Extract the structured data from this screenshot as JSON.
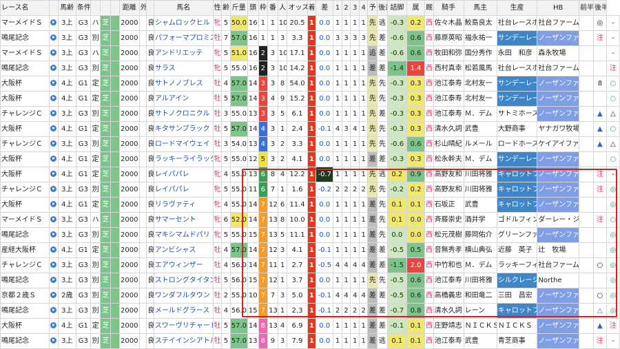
{
  "headers": [
    "レース名",
    "",
    "馬齢",
    "条件",
    "",
    "",
    "",
    "距離",
    "外",
    "",
    "馬名",
    "性",
    "齢",
    "斤量",
    "頭",
    "枠",
    "番",
    "人",
    "オッズ",
    "着",
    "差",
    "1",
    "2",
    "3",
    "4",
    "予",
    "後差",
    "詰脚",
    "属",
    "厩舎",
    "騎手",
    "馬主",
    "生産",
    "HB",
    "前半",
    "後半"
  ],
  "rows": [
    [
      "マーメイドＳ",
      "",
      "3上",
      "G3",
      "ハ",
      "芝",
      "",
      "2000",
      "",
      "良",
      "シャムロックヒル",
      "牝",
      "5",
      "50.0",
      "16",
      "1",
      "1",
      "10",
      "20.5",
      "1",
      "0.0",
      "1",
      "1",
      "1",
      "1",
      "先",
      "逃",
      "-0.3",
      "0.2",
      "西",
      "佐々木晶",
      "鮫島良太",
      "社台レースホ",
      "社台ファーム",
      "",
      "◎",
      "-"
    ],
    [
      "鳴尾記念",
      "",
      "3上",
      "G3",
      "別",
      "芝",
      "",
      "2000",
      "",
      "良",
      "パフォーマプロミス",
      "牡",
      "7",
      "57.0",
      "16",
      "1",
      "1",
      "3",
      "3.3",
      "1",
      "0.0",
      "3",
      "3",
      "3",
      "3",
      "先",
      "差",
      "-0.6",
      "0.6",
      "西",
      "藤原英昭",
      "福永祐一",
      "サンデーレー",
      "ノーザンファ",
      "",
      "注",
      "-"
    ],
    [
      "マーメイドＳ",
      "",
      "3上",
      "G3",
      "ハ",
      "芝",
      "",
      "2000",
      "",
      "良",
      "アンドリエッテ",
      "牝",
      "5",
      "51.0",
      "16",
      "2",
      "3",
      "10",
      "17.1",
      "1",
      "0.0",
      "1",
      "1",
      "1",
      "1",
      "追",
      "差",
      "-0.6",
      "0.6",
      "西",
      "牧田和弥",
      "国分秀作",
      "永田　和彦",
      "森永牧場",
      "",
      "",
      "-"
    ],
    [
      "鳴尾記念",
      "",
      "3上",
      "G3",
      "別",
      "芝",
      "",
      "2000",
      "",
      "良",
      "サラス",
      "牝",
      "5",
      "55.0",
      "16",
      "2",
      "3",
      "10",
      "14.2",
      "1",
      "0.0",
      "1",
      "1",
      "1",
      "1",
      "差",
      "差",
      "-1.4",
      "1.4",
      "西",
      "西村真幸",
      "松若風馬",
      "社台レースホ",
      "社台ファーム",
      "",
      "",
      "注"
    ],
    [
      "大阪杯",
      "",
      "4上",
      "G1",
      "定",
      "芝",
      "",
      "2000",
      "",
      "良",
      "サトノノブレス",
      "牡",
      "4",
      "57.0",
      "14",
      "3",
      "3",
      "8",
      "54.0",
      "1",
      "0.0",
      "1",
      "1",
      "1",
      "1",
      "先",
      "先",
      "-0.3",
      "0.3",
      "西",
      "池江泰寿",
      "北村友一",
      "サンデーレー",
      "ノーザンファ",
      "",
      "8",
      "○"
    ],
    [
      "大阪杯",
      "",
      "4上",
      "G1",
      "定",
      "芝",
      "",
      "2000",
      "",
      "良",
      "アルアイン",
      "牡",
      "5",
      "57.0",
      "14",
      "3",
      "4",
      "9",
      "15.2",
      "1",
      "0.0",
      "1",
      "1",
      "1",
      "1",
      "先",
      "先",
      "-0.3",
      "0.3",
      "西",
      "池江泰寿",
      "北村友一",
      "サンデーレー",
      "ノーザンファ",
      "",
      "",
      "○"
    ],
    [
      "チャレンジＣ",
      "",
      "3上",
      "G3",
      "別",
      "芝",
      "",
      "2000",
      "",
      "良",
      "サトノクロニクル",
      "牡",
      "3",
      "55.0",
      "13",
      "3",
      "3",
      "5",
      "6.1",
      "1",
      "0.0",
      "1",
      "1",
      "1",
      "1",
      "先",
      "差",
      "-0.3",
      "0.3",
      "西",
      "池江泰寿",
      "Ｍ．デム",
      "サトミホース",
      "ノーザンファ",
      "",
      "▲",
      "△"
    ],
    [
      "大阪杯",
      "",
      "4上",
      "G1",
      "定",
      "芝",
      "",
      "2000",
      "",
      "良",
      "キタサンブラック",
      "牡",
      "5",
      "57.0",
      "14",
      "4",
      "3",
      "1",
      "2.4",
      "1",
      "-0.1",
      "4",
      "3",
      "4",
      "1",
      "先",
      "先",
      "-0.3",
      "0.3",
      "西",
      "清水久詞",
      "武豊",
      "大野商事",
      "ヤナガワ牧場",
      "",
      "▲",
      "○"
    ],
    [
      "チャレンジＣ",
      "",
      "3上",
      "G3",
      "別",
      "芝",
      "",
      "2000",
      "",
      "良",
      "ロードマイウェイ",
      "牡",
      "3",
      "54.0",
      "13",
      "4",
      "3",
      "2",
      "3.3",
      "1",
      "0.0",
      "1",
      "1",
      "1",
      "1",
      "先",
      "先",
      "-0.6",
      "0.6",
      "西",
      "杉山晴紀",
      "ルメール",
      "ロードホース",
      "ケイアイファ",
      "",
      "▲",
      "△"
    ],
    [
      "大阪杯",
      "",
      "4上",
      "G1",
      "定",
      "芝",
      "",
      "2000",
      "",
      "良",
      "ラッキーライラック",
      "牝",
      "5",
      "55.0",
      "12",
      "5",
      "3",
      "2",
      "4.1",
      "1",
      "0.0",
      "1",
      "1",
      "1",
      "1",
      "差",
      "差",
      "-0.3",
      "0.3",
      "西",
      "松永幹夫",
      "Ｍ．デム",
      "サンデーレー",
      "ノーザンファ",
      "",
      "",
      "○"
    ],
    [
      "大阪杯",
      "",
      "4上",
      "G1",
      "定",
      "芝",
      "",
      "2000",
      "",
      "良",
      "レイパパレ",
      "牝",
      "4",
      "55.0",
      "13",
      "6",
      "8",
      "4",
      "12.2",
      "1",
      "-0.7",
      "1",
      "1",
      "1",
      "1",
      "先",
      "逃",
      "0.2",
      "0.9",
      "西",
      "高野友和",
      "川田将雅",
      "キャロットフ",
      "ノーザンファ",
      "",
      "注",
      "-"
    ],
    [
      "チャレンジＣ",
      "",
      "3上",
      "G3",
      "別",
      "芝",
      "",
      "2000",
      "",
      "良",
      "レイパパレ",
      "牝",
      "5",
      "55.0",
      "11",
      "6",
      "7",
      "1",
      "1.6",
      "1",
      "-0.2",
      "2",
      "2",
      "2",
      "2",
      "先",
      "先",
      "-0.2",
      "0.2",
      "西",
      "高野友和",
      "川田将雅",
      "キャロットフ",
      "ノーザンファ",
      "",
      "注",
      "◎"
    ],
    [
      "大阪杯",
      "",
      "4上",
      "G1",
      "定",
      "芝",
      "",
      "2000",
      "",
      "良",
      "リラヴァティ",
      "牝",
      "4",
      "55.0",
      "14",
      "7",
      "12",
      "6",
      "11.4",
      "1",
      "0.0",
      "1",
      "1",
      "1",
      "1",
      "差",
      "先",
      "0.1",
      "0.1",
      "西",
      "石坂正",
      "武豊",
      "キャロットフ",
      "ノーザンファ",
      "",
      "",
      "◎"
    ],
    [
      "マーメイドＳ",
      "",
      "3上",
      "G3",
      "ハ",
      "芝",
      "",
      "2000",
      "",
      "良",
      "サマーセント",
      "牝",
      "6",
      "52.0",
      "14",
      "7",
      "13",
      "8",
      "10.0",
      "1",
      "0.0",
      "1",
      "1",
      "1",
      "1",
      "差",
      "先",
      "0.1",
      "0.0",
      "西",
      "斉藤崇史",
      "酒井学",
      "ゴドルフィン",
      "ダーレー・ジ",
      "",
      "注",
      "○"
    ],
    [
      "鳴尾記念",
      "",
      "3上",
      "G3",
      "別",
      "芝",
      "",
      "2000",
      "",
      "良",
      "マキシマムドパリ",
      "牝",
      "5",
      "55.0",
      "15",
      "7",
      "13",
      "5",
      "11.1",
      "1",
      "0.0",
      "1",
      "1",
      "1",
      "1",
      "差",
      "先",
      "0.0",
      "0.0",
      "西",
      "松元茂樹",
      "藤岡佑介",
      "グリーンファ",
      "ノーザンファ",
      "",
      "",
      "◎"
    ],
    [
      "産経大阪杯",
      "",
      "4上",
      "G1",
      "定",
      "芝",
      "",
      "2000",
      "",
      "良",
      "アンビシャス",
      "牡",
      "4",
      "57.0",
      "14",
      "7",
      "12",
      "3",
      "4.1",
      "1",
      "-0.1",
      "1",
      "1",
      "1",
      "1",
      "差",
      "差",
      "-0.5",
      "0.5",
      "西",
      "音無秀孝",
      "横山典弘",
      "近藤　英子",
      "辻　牧場",
      "",
      "",
      "◎"
    ],
    [
      "チャレンジＣ",
      "",
      "3上",
      "G3",
      "別",
      "芝",
      "",
      "2000",
      "",
      "良",
      "エアウィンザー",
      "牡",
      "4",
      "56.0",
      "14",
      "7",
      "11",
      "1",
      "2.7",
      "1",
      "-0.5",
      "4",
      "4",
      "4",
      "4",
      "差",
      "差",
      "-1.5",
      "2.0",
      "西",
      "中竹和也",
      "Ｍ．デム",
      "ラッキーフィ",
      "社台ファーム",
      "",
      "○",
      "◎"
    ],
    [
      "鳴尾記念",
      "",
      "3上",
      "G3",
      "別",
      "芝",
      "",
      "2000",
      "",
      "良",
      "ストロングタイタン",
      "牡",
      "5",
      "56.0",
      "15",
      "7",
      "12",
      "1",
      "3.7",
      "1",
      "0.0",
      "1",
      "1",
      "1",
      "1",
      "先",
      "先",
      "-0.5",
      "0.6",
      "西",
      "池江泰寿",
      "川田将雅",
      "シルクレーシ",
      "Northe",
      "",
      "",
      "◎"
    ],
    [
      "京都２歳Ｓ",
      "",
      "2歳",
      "G3",
      "別",
      "芝",
      "",
      "2000",
      "",
      "良",
      "ワンダフルタウン",
      "牡",
      "2",
      "55.0",
      "10",
      "7",
      "7",
      "3",
      "5.0",
      "1",
      "-0.1",
      "4",
      "4",
      "4",
      "4",
      "差",
      "差",
      "-0.5",
      "0.6",
      "西",
      "高橋義忠",
      "和田竜二",
      "三田　昌宏",
      "ノーザンファ",
      "",
      "○",
      "◎"
    ],
    [
      "鳴尾記念",
      "",
      "3上",
      "G3",
      "別",
      "芝",
      "",
      "2000",
      "",
      "良",
      "メールドグラース",
      "牡",
      "4",
      "56.0",
      "15",
      "7",
      "13",
      "1",
      "2.3",
      "1",
      "-0.1",
      "2",
      "2",
      "2",
      "2",
      "差",
      "差",
      "-0.7",
      "0.8",
      "西",
      "清水久詞",
      "レーン",
      "キャロットフ",
      "ノーザンファ",
      "",
      "△",
      "◎"
    ],
    [
      "大阪杯",
      "",
      "4上",
      "G1",
      "定",
      "芝",
      "",
      "2000",
      "",
      "良",
      "スワーヴリチャード",
      "牡",
      "5",
      "57.0",
      "14",
      "8",
      "13",
      "4",
      "6.9",
      "1",
      "0.0",
      "1",
      "1",
      "1",
      "1",
      "差",
      "差",
      "-0.1",
      "0.1",
      "西",
      "庄野靖志",
      "ＮＩＣＫＳ",
      "ＮＩＣＫＳ",
      "ノーザンファ",
      "",
      "▲",
      "注"
    ],
    [
      "鳴尾記念",
      "",
      "3上",
      "G3",
      "別",
      "芝",
      "",
      "2000",
      "",
      "良",
      "ステイインシアトル",
      "牡",
      "5",
      "57.0",
      "13",
      "8",
      "9",
      "3",
      "7.9",
      "1",
      "0.0",
      "1",
      "1",
      "1",
      "1",
      "差",
      "逃",
      "0.1",
      "0.1",
      "西",
      "池江泰寿",
      "武豊",
      "青芝商事",
      "ノーザンファ",
      "",
      "注",
      "-"
    ]
  ],
  "colors": {
    "frame1": "#ffffff",
    "frame2": "#222222",
    "frame3": "#e64640",
    "frame4": "#3a6fd6",
    "frame5": "#f0e040",
    "frame6": "#3aa050",
    "frame7": "#f29c2b",
    "frame8": "#e86ab0"
  },
  "selection": {
    "label": "selected-rows"
  }
}
